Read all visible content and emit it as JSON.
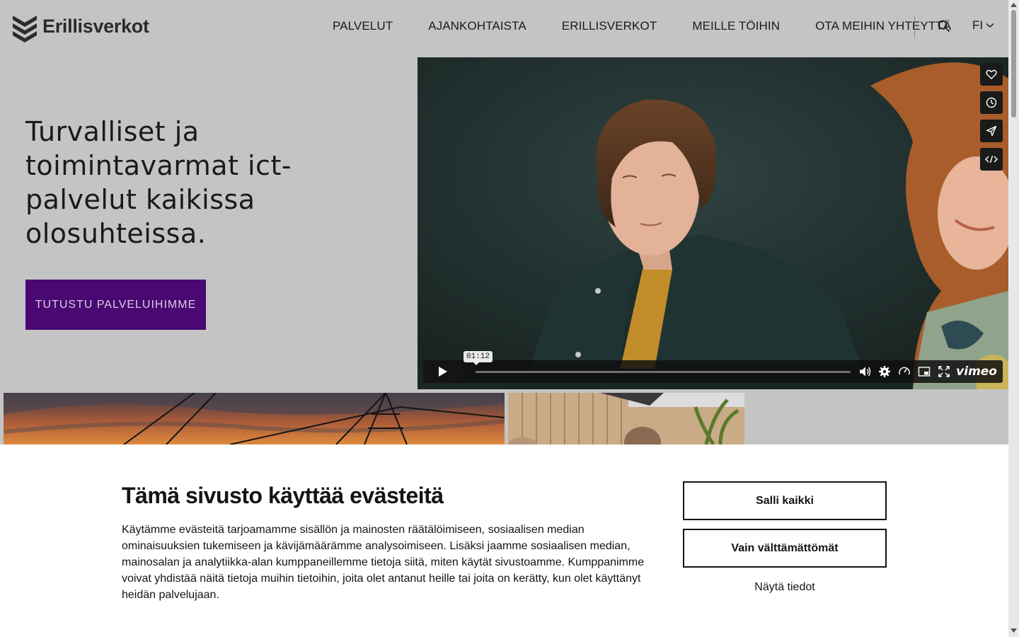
{
  "header": {
    "logo_text": "Erillisverkot",
    "nav": [
      "PALVELUT",
      "AJANKOHTAISTA",
      "ERILLISVERKOT",
      "MEILLE TÖIHIN",
      "OTA MEIHIN YHTEYTTÄ"
    ],
    "language": "FI"
  },
  "hero": {
    "title": "Turvalliset ja toimintavarmat ict-palvelut kaikissa olosuhteissa.",
    "cta": "TUTUSTU PALVELUIHIMME"
  },
  "video": {
    "time_tooltip": "01:12",
    "brand": "vimeo",
    "side_icons": [
      "heart-icon",
      "clock-icon",
      "send-icon",
      "embed-code-icon"
    ],
    "control_icons": [
      "volume-icon",
      "settings-icon",
      "speed-icon",
      "picture-in-picture-icon",
      "fullscreen-icon"
    ]
  },
  "cookie_banner": {
    "title": "Tämä sivusto käyttää evästeitä",
    "text": "Käytämme evästeitä tarjoamamme sisällön ja mainosten räätälöimiseen, sosiaalisen median ominaisuuksien tukemiseen ja kävijämäärämme analysoimiseen. Lisäksi jaamme sosiaalisen median, mainosalan ja analytiikka-alan kumppaneillemme tietoja siitä, miten käytät sivustoamme. Kumppanimme voivat yhdistää näitä tietoja muihin tietoihin, joita olet antanut heille tai joita on kerätty, kun olet käyttänyt heidän palvelujaan.",
    "allow_all": "Salli kaikki",
    "necessary_only": "Vain välttämättömät",
    "show_details": "Näytä tiedot"
  },
  "colors": {
    "accent": "#4a0872",
    "page_bg": "#c4c4c5",
    "banner_bg": "#ffffff"
  }
}
